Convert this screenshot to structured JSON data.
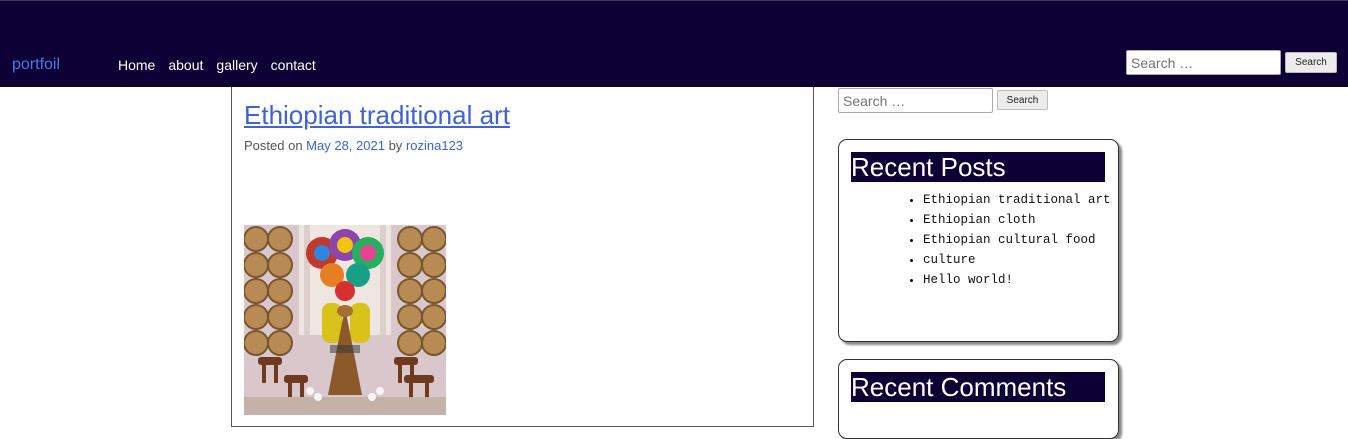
{
  "header": {
    "brand": "portfoil",
    "nav": [
      "Home",
      "about",
      "gallery",
      "contact"
    ],
    "search_placeholder": "Search …",
    "search_button": "Search"
  },
  "post": {
    "title": "Ethiopian traditional art",
    "meta_prefix": "Posted on",
    "date": "May 28, 2021",
    "by": "by",
    "author": "rozina123"
  },
  "sidebar": {
    "search_placeholder": "Search …",
    "search_button": "Search",
    "recent_posts": {
      "title": "Recent Posts",
      "items": [
        "Ethiopian traditional art",
        "Ethiopian cloth",
        "Ethiopian cultural food",
        "culture",
        "Hello world!"
      ]
    },
    "recent_comments": {
      "title": "Recent Comments"
    }
  },
  "colors": {
    "header_bg": "#0c0035",
    "link": "#3e63d6",
    "brand": "#4d77e6"
  }
}
